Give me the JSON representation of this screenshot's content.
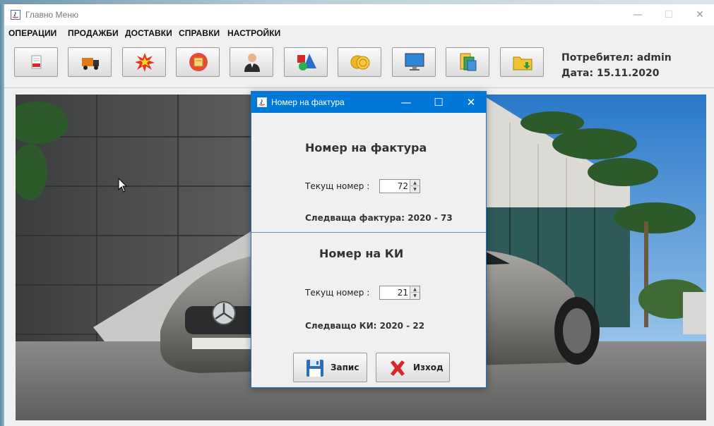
{
  "window": {
    "title": "Главно Меню",
    "minimize": "—",
    "maximize": "☐",
    "close": "✕"
  },
  "menu": [
    "ОПЕРАЦИИ",
    "ПРОДАЖБИ",
    "ДОСТАВКИ",
    "СПРАВКИ",
    "НАСТРОЙКИ"
  ],
  "toolbar": {
    "icons": [
      "sale-receipt-icon",
      "delivery-truck-icon",
      "burst-icon",
      "folder-icon",
      "user-icon",
      "shapes-icon",
      "coins-icon",
      "monitor-icon",
      "files-icon",
      "archive-folder-icon"
    ]
  },
  "user": {
    "user_line": "Потребител: admin",
    "date_line": "Дата: 15.11.2020"
  },
  "dialog": {
    "title": "Номер на фактура",
    "minimize": "—",
    "maximize": "☐",
    "close": "✕",
    "invoice": {
      "heading": "Номер на фактура",
      "current_label": "Текущ номер :",
      "current_value": "72",
      "next_label": "Следваща фактура: 2020 - 73"
    },
    "ki": {
      "heading": "Номер на КИ",
      "current_label": "Текущ номер :",
      "current_value": "21",
      "next_label": "Следващо КИ: 2020 - 22"
    },
    "save_label": "Запис",
    "exit_label": "Изход"
  },
  "colors": {
    "dialog_titlebar": "#0078d7",
    "exit_icon": "#d9262a",
    "save_icon": "#2a6fb8"
  }
}
